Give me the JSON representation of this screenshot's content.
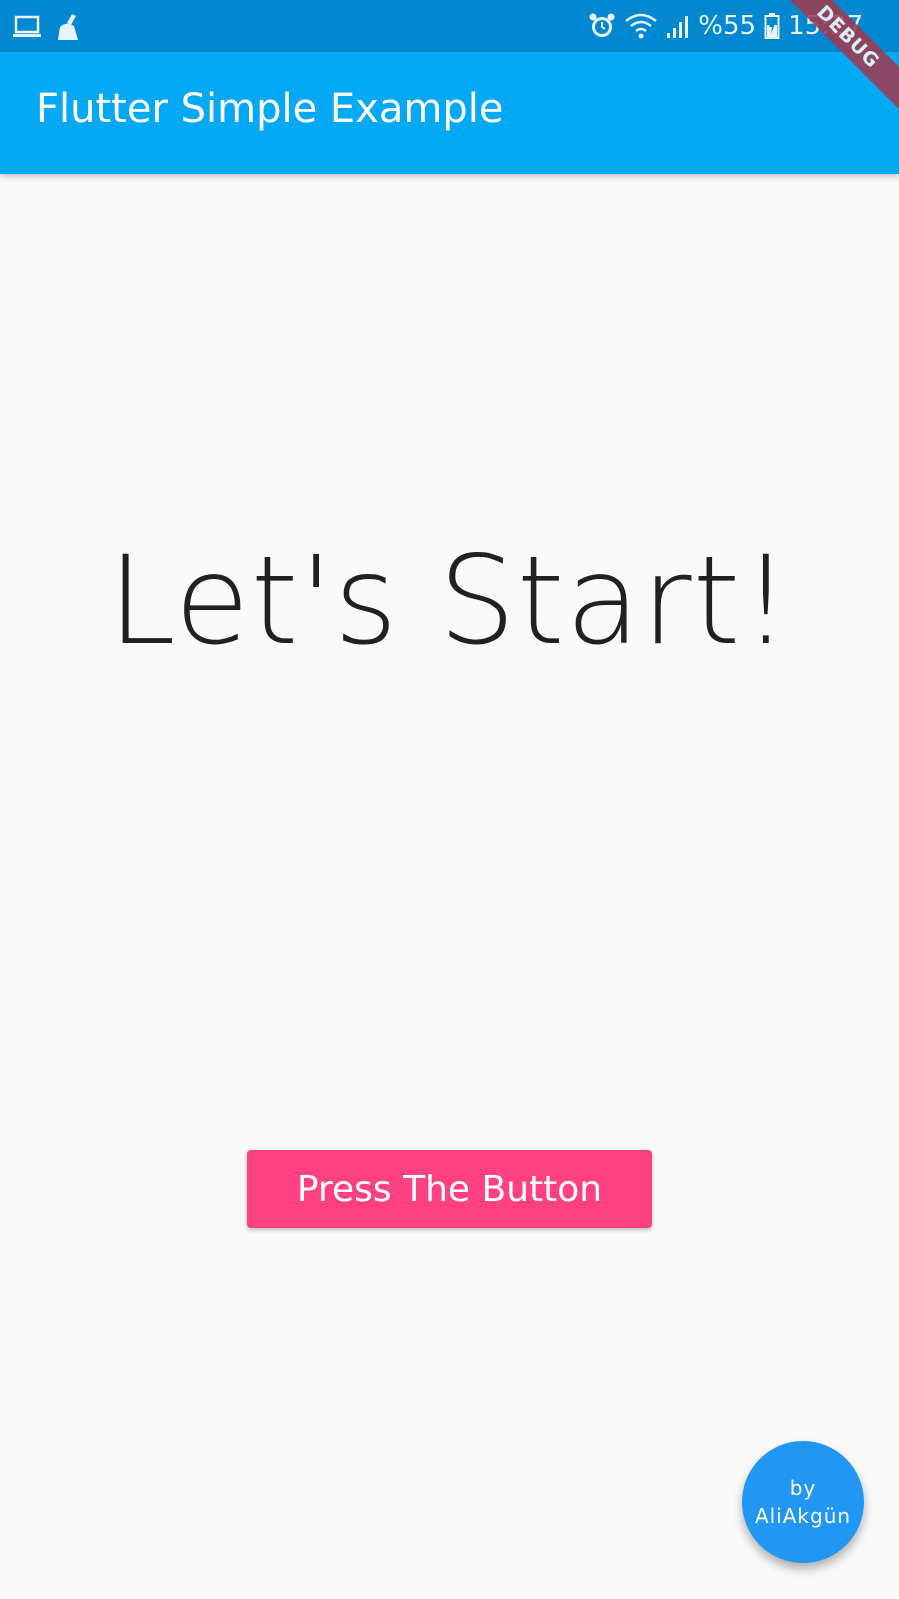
{
  "status_bar": {
    "battery_text": "%55",
    "time": "15:27",
    "left_icons": [
      "laptop-icon",
      "cleaner-icon"
    ],
    "right_icons": [
      "alarm-icon",
      "wifi-icon",
      "signal-icon",
      "battery-icon"
    ]
  },
  "app_bar": {
    "title": "Flutter Simple Example",
    "color": "#03a9f4"
  },
  "debug_banner": {
    "label": "DEBUG"
  },
  "main": {
    "headline": "Let's Start!",
    "button_label": "Press The Button",
    "button_color": "#ff4081"
  },
  "fab": {
    "line1": "by",
    "line2": "AliAkgün",
    "color": "#2196f3"
  }
}
